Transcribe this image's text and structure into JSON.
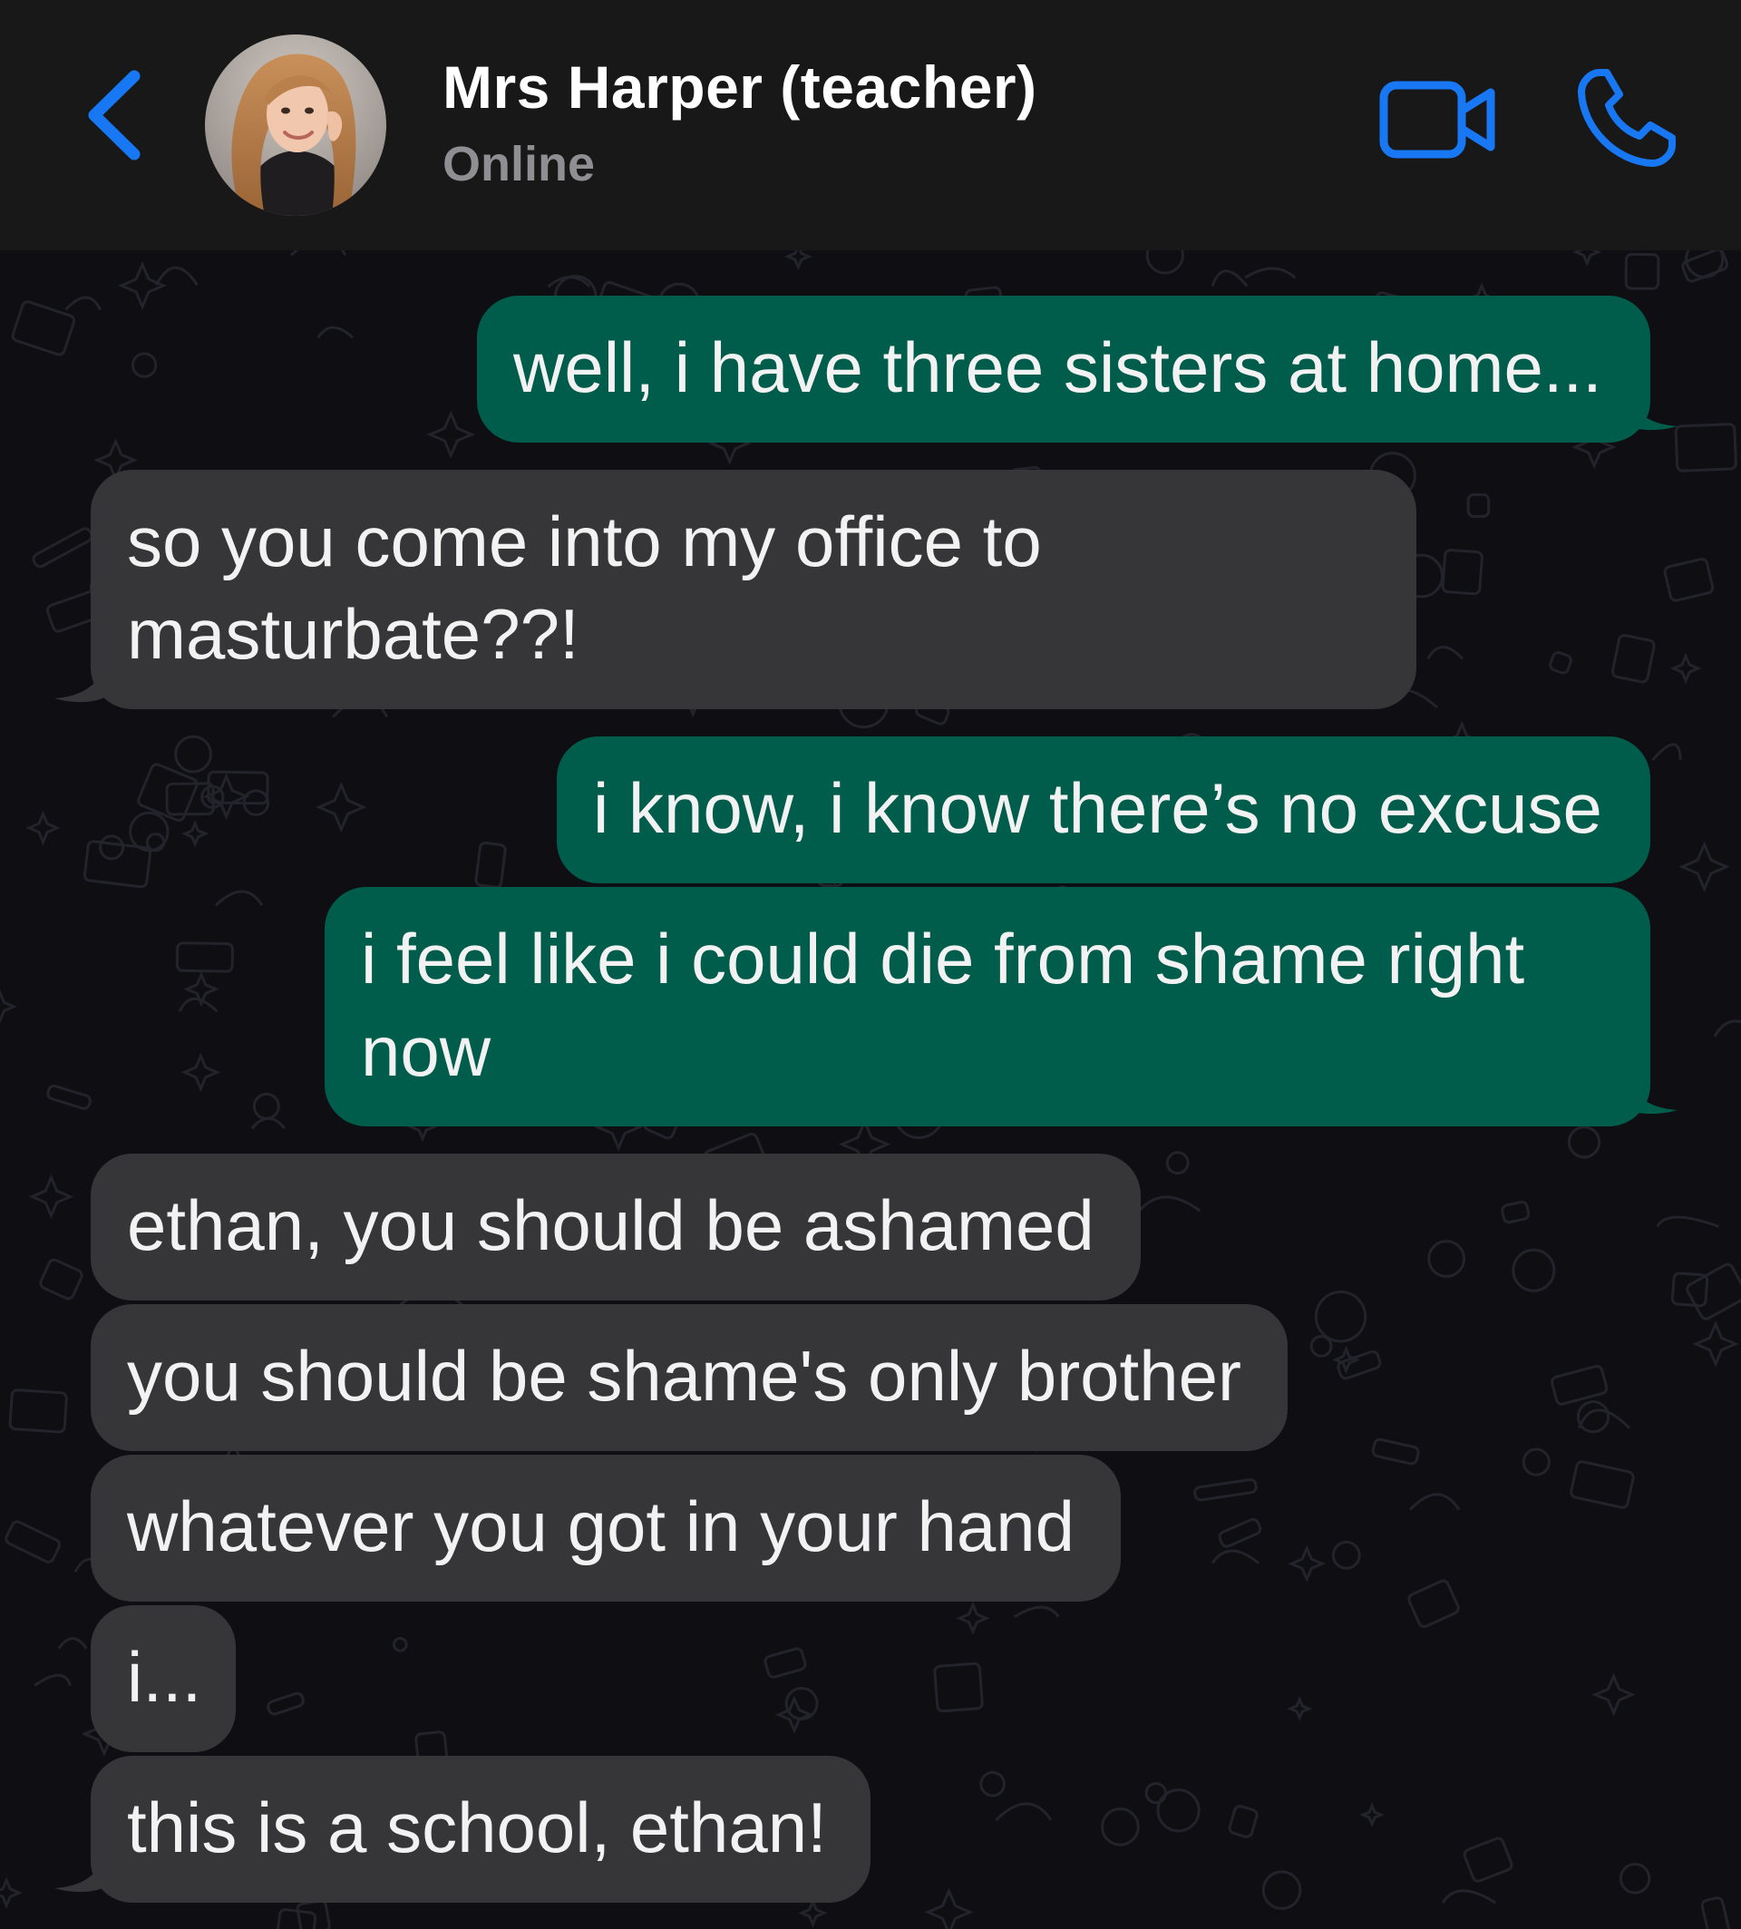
{
  "header": {
    "contact_name": "Mrs Harper (teacher)",
    "status": "Online",
    "accent_color": "#1877f2",
    "icons": [
      "chevron-left-icon",
      "video-camera-icon",
      "phone-icon"
    ]
  },
  "theme": {
    "outgoing_bubble": "#005c4b",
    "incoming_bubble": "#363638",
    "background": "#0e0e13"
  },
  "messages": [
    {
      "direction": "outgoing",
      "lines": [
        "well, i have three sisters at home..."
      ]
    },
    {
      "direction": "incoming",
      "lines": [
        "so you come into my office to",
        "masturbate??!"
      ]
    },
    {
      "direction": "outgoing",
      "lines": [
        "i know, i know there’s no excuse"
      ]
    },
    {
      "direction": "outgoing",
      "lines": [
        "i feel like i could die from shame right",
        "now"
      ]
    },
    {
      "direction": "incoming",
      "lines": [
        "ethan, you should be ashamed"
      ]
    },
    {
      "direction": "incoming",
      "lines": [
        "you should be shame's only brother"
      ]
    },
    {
      "direction": "incoming",
      "lines": [
        "whatever you got in your hand"
      ]
    },
    {
      "direction": "incoming",
      "lines": [
        "i..."
      ]
    },
    {
      "direction": "incoming",
      "lines": [
        "this is a school, ethan!"
      ]
    }
  ]
}
